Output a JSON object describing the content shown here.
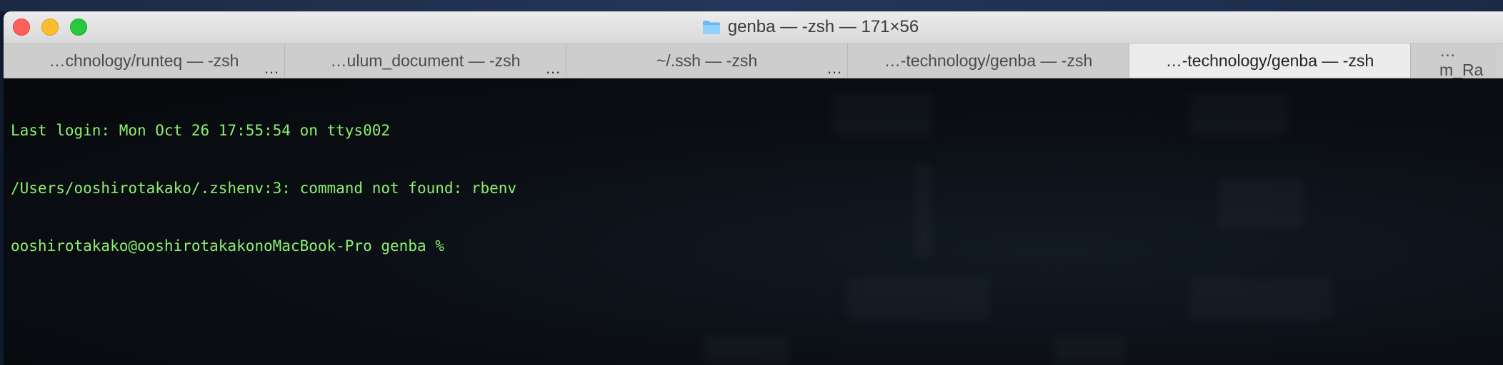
{
  "window": {
    "title": "genba — -zsh — 171×56"
  },
  "tabs": [
    {
      "label": "…chnology/runteq — -zsh",
      "more": "…",
      "active": false
    },
    {
      "label": "…ulum_document — -zsh",
      "more": "…",
      "active": false
    },
    {
      "label": "~/.ssh — -zsh",
      "more": "…",
      "active": false
    },
    {
      "label": "…-technology/genba — -zsh",
      "more": "",
      "active": false
    },
    {
      "label": "…-technology/genba — -zsh",
      "more": "",
      "active": true
    },
    {
      "label": "…m_Ra",
      "more": "",
      "active": false
    }
  ],
  "terminal": {
    "lines": [
      "Last login: Mon Oct 26 17:55:54 on ttys002",
      "/Users/ooshirotakako/.zshenv:3: command not found: rbenv",
      "ooshirotakako@ooshirotakakonoMacBook-Pro genba % "
    ],
    "text_color": "#8cf06e",
    "background": "#0a0d12"
  },
  "icons": {
    "title": "folder-icon",
    "close": "close-icon",
    "minimize": "minimize-icon",
    "zoom": "zoom-icon",
    "tab_overflow": "ellipsis-icon"
  }
}
